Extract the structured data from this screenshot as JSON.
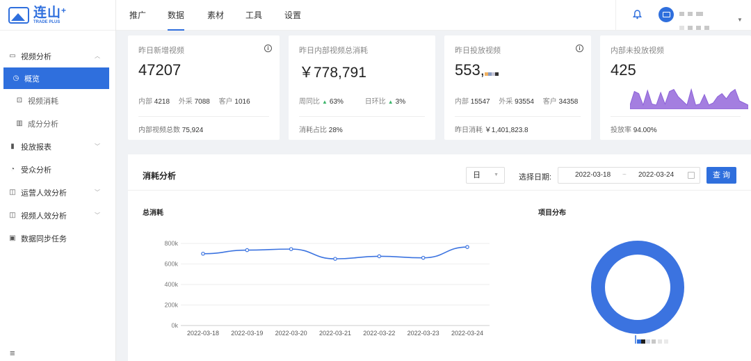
{
  "brand": {
    "name_cn": "连山",
    "plus": "+",
    "name_en": "TRADE PLUS"
  },
  "nav": {
    "tabs": [
      "推广",
      "数据",
      "素材",
      "工具",
      "设置"
    ],
    "active": 1
  },
  "user": {
    "icons": [
      "bell-icon",
      "avatar-icon",
      "chevron-down-icon"
    ]
  },
  "sidebar": {
    "items": [
      {
        "label": "视频分析",
        "icon": "video-icon",
        "level": 1,
        "expanded": true
      },
      {
        "label": "概览",
        "icon": "clock-icon",
        "level": 2,
        "active": true
      },
      {
        "label": "视频消耗",
        "icon": "chart-box-icon",
        "level": 2
      },
      {
        "label": "成分分析",
        "icon": "bar-chart-icon",
        "level": 2
      },
      {
        "label": "投放报表",
        "icon": "report-icon",
        "level": 1,
        "expanded": false
      },
      {
        "label": "受众分析",
        "icon": "pie-icon",
        "level": 1
      },
      {
        "label": "运营人效分析",
        "icon": "shield-icon",
        "level": 1,
        "expanded": false
      },
      {
        "label": "视频人效分析",
        "icon": "shield-icon",
        "level": 1,
        "expanded": false
      },
      {
        "label": "数据同步任务",
        "icon": "sync-icon",
        "level": 1
      }
    ]
  },
  "cards": {
    "new_video": {
      "title": "昨日新增视频",
      "value": "47207",
      "meta": [
        {
          "k": "内部",
          "v": "4218"
        },
        {
          "k": "外采",
          "v": "7088"
        },
        {
          "k": "客户",
          "v": "1016"
        }
      ],
      "foot_label": "内部视频总数",
      "foot_value": "75,924"
    },
    "internal_cost": {
      "title": "昨日内部视频总消耗",
      "value": "￥778,791",
      "wow_label": "周同比",
      "wow_value": "63%",
      "dod_label": "日环比",
      "dod_value": "3%",
      "foot_label": "消耗占比",
      "foot_value": "28%"
    },
    "placed_video": {
      "title": "昨日投放视频",
      "value": "553,",
      "meta": [
        {
          "k": "内部",
          "v": "15547"
        },
        {
          "k": "外采",
          "v": "93554"
        },
        {
          "k": "客户",
          "v": "34358"
        }
      ],
      "foot_label": "昨日消耗",
      "foot_value": "￥1,401,823.8"
    },
    "unplaced_video": {
      "title": "内部未投放视频",
      "value": "425",
      "foot_label": "投放率",
      "foot_value": "94.00%",
      "sparkline": [
        0.2,
        0.85,
        0.75,
        0.2,
        0.9,
        0.25,
        0.2,
        0.8,
        0.25,
        0.85,
        0.95,
        0.6,
        0.4,
        0.2,
        0.95,
        0.2,
        0.25,
        0.7,
        0.2,
        0.3,
        0.6,
        0.75,
        0.5,
        0.8,
        0.95,
        0.4,
        0.3,
        0.2
      ],
      "color": "#a47ee0"
    }
  },
  "analysis": {
    "title": "消耗分析",
    "unit_value": "日",
    "date_label": "选择日期:",
    "date_start": "2022-03-18",
    "date_sep": "~",
    "date_end": "2022-03-24",
    "query_label": "查 询",
    "line_title": "总消耗",
    "donut_title": "项目分布"
  },
  "chart_data": [
    {
      "type": "line",
      "title": "总消耗",
      "x": [
        "2022-03-18",
        "2022-03-19",
        "2022-03-20",
        "2022-03-21",
        "2022-03-22",
        "2022-03-23",
        "2022-03-24"
      ],
      "series": [
        {
          "values": [
            700000,
            735000,
            745000,
            650000,
            675000,
            660000,
            765000
          ]
        }
      ],
      "yticks": [
        "0k",
        "200k",
        "400k",
        "600k",
        "800k"
      ],
      "ylim": [
        0,
        800000
      ],
      "color": "#3b73e0",
      "grid": true
    },
    {
      "type": "pie",
      "title": "项目分布",
      "values": [
        1
      ],
      "color": "#3b73e0",
      "donut": true
    }
  ]
}
